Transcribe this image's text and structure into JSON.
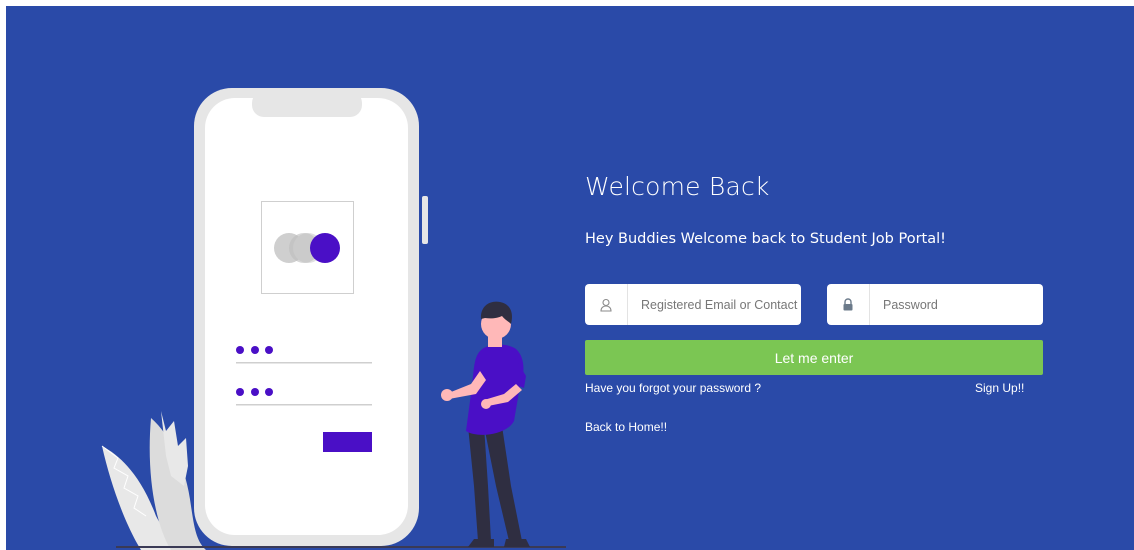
{
  "login": {
    "title": "Welcome Back",
    "subtitle": "Hey Buddies Welcome back to Student Job Portal!",
    "email_placeholder": "Registered Email or Contact",
    "password_placeholder": "Password",
    "submit_label": "Let me enter",
    "forgot_label": "Have you forgot your password ?",
    "signup_label": "Sign Up!!",
    "home_label": "Back to Home!!"
  },
  "icons": {
    "email": "user-icon",
    "password": "lock-icon"
  },
  "colors": {
    "background": "#2a4aa8",
    "accent": "#4a0fc6",
    "button": "#7bc653",
    "phone": "#e6e6e6"
  }
}
